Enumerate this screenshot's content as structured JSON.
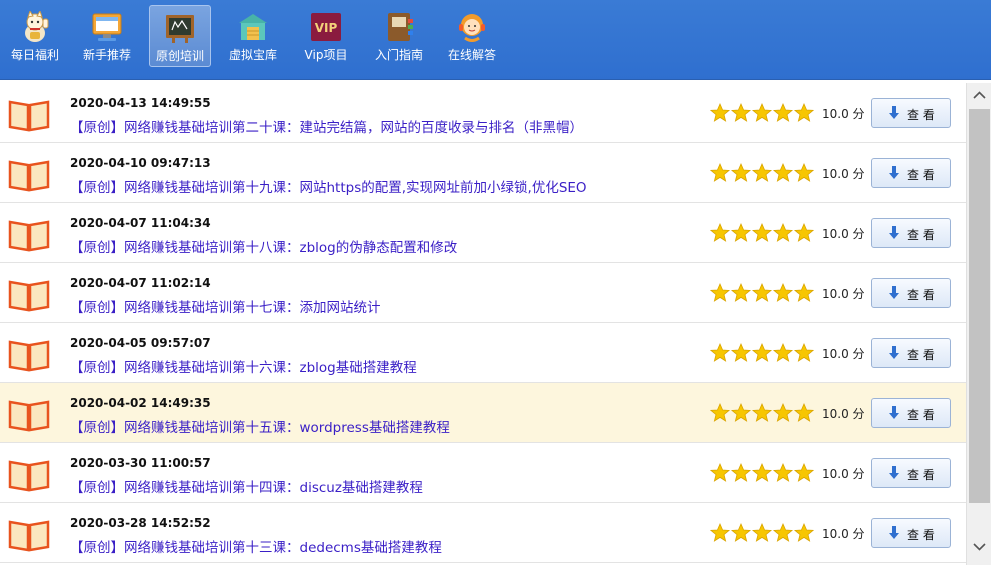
{
  "toolbar": {
    "items": [
      {
        "label": "每日福利",
        "icon": "lucky-cat-icon"
      },
      {
        "label": "新手推荐",
        "icon": "monitor-icon"
      },
      {
        "label": "原创培训",
        "icon": "chalkboard-icon",
        "active": true
      },
      {
        "label": "虚拟宝库",
        "icon": "storehouse-icon"
      },
      {
        "label": "Vip项目",
        "icon": "vip-badge-icon",
        "badge_text": "VIP"
      },
      {
        "label": "入门指南",
        "icon": "notebook-icon"
      },
      {
        "label": "在线解答",
        "icon": "support-agent-icon"
      }
    ]
  },
  "list": {
    "view_label": "查 看",
    "score_unit": "分",
    "rows": [
      {
        "date": "2020-04-13 14:49:55",
        "title": "【原创】网络赚钱基础培训第二十课：建站完结篇，网站的百度收录与排名（非黑帽）",
        "stars": 5,
        "score": "10.0 分"
      },
      {
        "date": "2020-04-10 09:47:13",
        "title": "【原创】网络赚钱基础培训第十九课：网站https的配置,实现网址前加小绿锁,优化SEO",
        "stars": 5,
        "score": "10.0 分"
      },
      {
        "date": "2020-04-07 11:04:34",
        "title": "【原创】网络赚钱基础培训第十八课：zblog的伪静态配置和修改",
        "stars": 5,
        "score": "10.0 分"
      },
      {
        "date": "2020-04-07 11:02:14",
        "title": "【原创】网络赚钱基础培训第十七课：添加网站统计",
        "stars": 5,
        "score": "10.0 分"
      },
      {
        "date": "2020-04-05 09:57:07",
        "title": "【原创】网络赚钱基础培训第十六课：zblog基础搭建教程",
        "stars": 5,
        "score": "10.0 分"
      },
      {
        "date": "2020-04-02 14:49:35",
        "title": "【原创】网络赚钱基础培训第十五课：wordpress基础搭建教程",
        "stars": 5,
        "score": "10.0 分",
        "highlighted": true
      },
      {
        "date": "2020-03-30 11:00:57",
        "title": "【原创】网络赚钱基础培训第十四课：discuz基础搭建教程",
        "stars": 5,
        "score": "10.0 分"
      },
      {
        "date": "2020-03-28 14:52:52",
        "title": "【原创】网络赚钱基础培训第十三课：dedecms基础搭建教程",
        "stars": 5,
        "score": "10.0 分"
      }
    ]
  },
  "colors": {
    "toolbar_bg": "#3a7bd5",
    "title_link": "#3a1fc6",
    "star": "#f7c600",
    "book": "#e8531e",
    "highlight_row": "#fdf6dd"
  }
}
